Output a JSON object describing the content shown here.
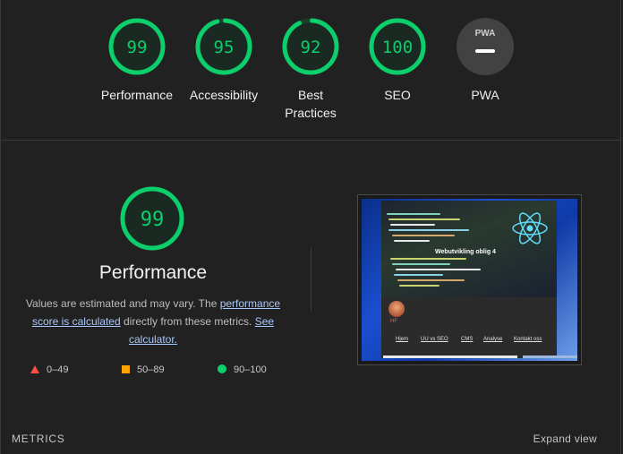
{
  "gauges": [
    {
      "label": "Performance",
      "score": "99",
      "fraction": 0.99
    },
    {
      "label": "Accessibility",
      "score": "95",
      "fraction": 0.95
    },
    {
      "label": "Best Practices",
      "score": "92",
      "fraction": 0.92
    },
    {
      "label": "SEO",
      "score": "100",
      "fraction": 1.0
    }
  ],
  "pwa": {
    "label": "PWA",
    "logo_text": "PWA"
  },
  "performance": {
    "score": "99",
    "fraction": 0.99,
    "title": "Performance",
    "desc_1": "Values are estimated and may vary. The ",
    "link_score": "performance score is calculated",
    "desc_2": " directly from these metrics. ",
    "link_calc": "See calculator."
  },
  "legend": {
    "fail": "0–49",
    "average": "50–89",
    "pass": "90–100"
  },
  "thumbnail": {
    "hero_title": "Webutvikling oblig 4",
    "avatar_text": "HF",
    "nav": [
      "Hjem",
      "UU vs SEO",
      "CMS",
      "Analyse",
      "Kontakt oss"
    ]
  },
  "footer": {
    "metrics": "METRICS",
    "expand": "Expand view"
  },
  "colors": {
    "pass": "#0cce6b",
    "average": "#ffa400",
    "fail": "#ff4e42",
    "background": "#212121"
  }
}
